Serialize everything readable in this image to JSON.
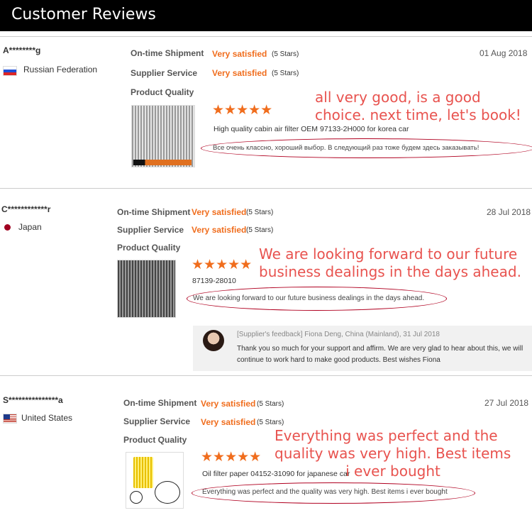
{
  "header": {
    "title": "Customer Reviews"
  },
  "labels": {
    "shipment": "On-time Shipment",
    "service": "Supplier Service",
    "quality": "Product Quality",
    "rating": "Very satisfied",
    "stars_note": "(5 Stars)",
    "stars": "★★★★★"
  },
  "reviews": [
    {
      "user": "A********g",
      "country": "Russian Federation",
      "date": "01 Aug 2018",
      "product": "High quality cabin air filter OEM 97133-2H000 for korea car",
      "text": "Все очень классно, хороший выбор. В следующий раз тоже будем здесь заказывать!",
      "translation_line1": "all very good, is a good",
      "translation_line2": "choice. next time, let's book!"
    },
    {
      "user": "C************r",
      "country": "Japan",
      "date": "28 Jul 2018",
      "product": "87139-28010",
      "text": "We are looking forward to our future business dealings in the days ahead.",
      "translation_line1": "We are looking forward to our future",
      "translation_line2": "business dealings in the days ahead.",
      "feedback": {
        "meta": "[Supplier's feedback] Fiona Deng, China (Mainland), 31 Jul 2018",
        "text": "Thank you so much for your support and affirm. We are very glad to hear about this, we will continue to work hard to make good products. Best wishes Fiona"
      }
    },
    {
      "user": "S***************a",
      "country": "United States",
      "date": "27 Jul 2018",
      "product": "Oil filter paper 04152-31090 for japanese car",
      "text": "Everything was perfect and the quality was very high. Best items i ever bought",
      "translation_line1": "Everything was perfect and the",
      "translation_line2": "quality was very high. Best items",
      "translation_line3": "i ever bought"
    }
  ],
  "colors": {
    "accent": "#f06d1d",
    "annotation": "#e8534f",
    "header_bg": "#000000"
  }
}
